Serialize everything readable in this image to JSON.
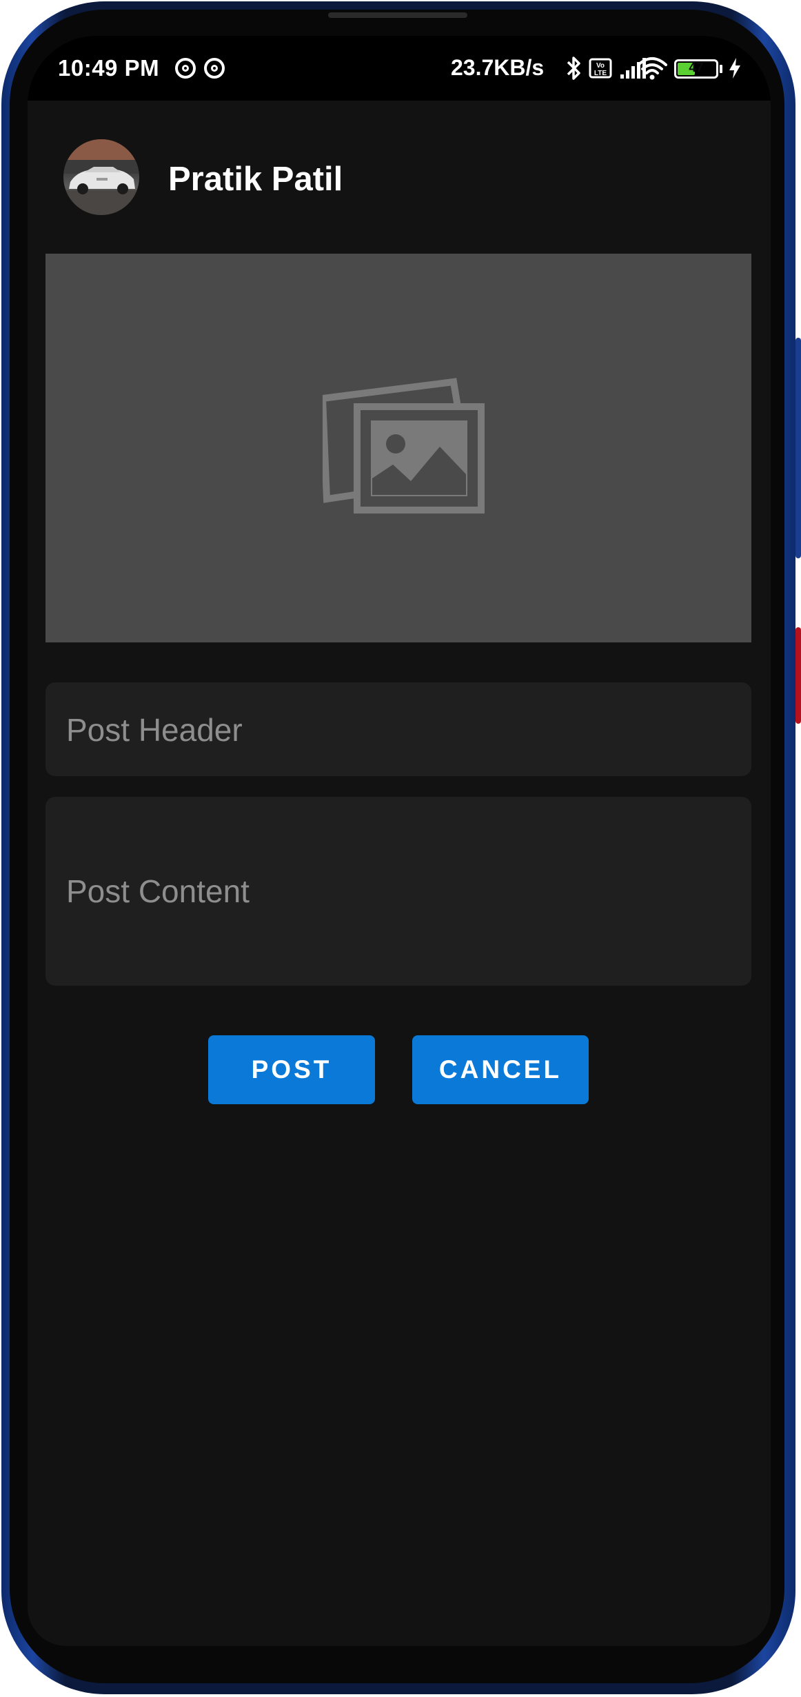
{
  "status_bar": {
    "time": "10:49 PM",
    "network_speed": "23.7KB/s",
    "battery_level": "47",
    "battery_fill_fraction": 0.47,
    "icons": [
      "notification-ring-icon",
      "notification-ring-icon",
      "bluetooth-icon",
      "volte-icon",
      "signal-icon",
      "wifi-icon",
      "battery-icon",
      "charging-icon"
    ]
  },
  "profile": {
    "name": "Pratik Patil",
    "avatar_icon": "avatar-photo"
  },
  "image_picker": {
    "icon": "image-gallery-icon"
  },
  "form": {
    "header_placeholder": "Post Header",
    "content_placeholder": "Post Content"
  },
  "actions": {
    "post_label": "POST",
    "cancel_label": "CANCEL"
  },
  "colors": {
    "background": "#121212",
    "accent": "#0a79d8",
    "field_background": "#1f1f1f",
    "image_box_background": "#4a4a4a",
    "phone_frame": "#1c45a0"
  }
}
